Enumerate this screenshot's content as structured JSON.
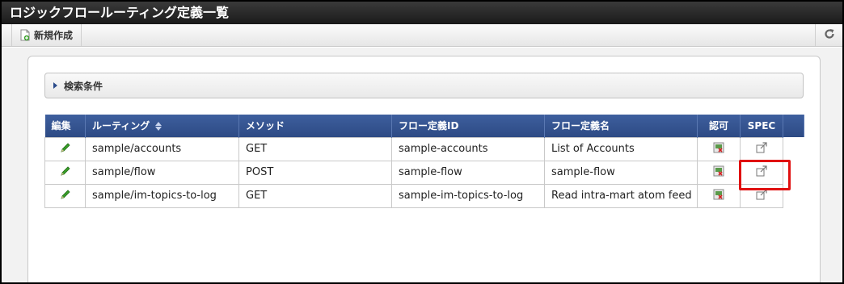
{
  "title": "ロジックフロールーティング定義一覧",
  "toolbar": {
    "new_label": "新規作成",
    "new_icon": "new-document-icon",
    "refresh_icon": "refresh-icon"
  },
  "search": {
    "label": "検索条件",
    "toggle_icon": "triangle-right-icon"
  },
  "table": {
    "columns": [
      "編集",
      "ルーティング",
      "メソッド",
      "フロー定義ID",
      "フロー定義名",
      "認可",
      "SPEC"
    ],
    "rows": [
      {
        "route": "sample/accounts",
        "method": "GET",
        "flow_id": "sample-accounts",
        "flow_name": "List of Accounts"
      },
      {
        "route": "sample/flow",
        "method": "POST",
        "flow_id": "sample-flow",
        "flow_name": "sample-flow"
      },
      {
        "route": "sample/im-topics-to-log",
        "method": "GET",
        "flow_id": "sample-im-topics-to-log",
        "flow_name": "Read intra-mart atom feed"
      }
    ],
    "edit_icon": "pencil-icon",
    "auth_icon": "authorization-icon",
    "spec_icon": "external-link-icon"
  },
  "colors": {
    "header_bg": "#2d4a84",
    "title_bg": "#1a1a1a",
    "highlight": "#e01010",
    "pencil": "#3aa02a"
  }
}
